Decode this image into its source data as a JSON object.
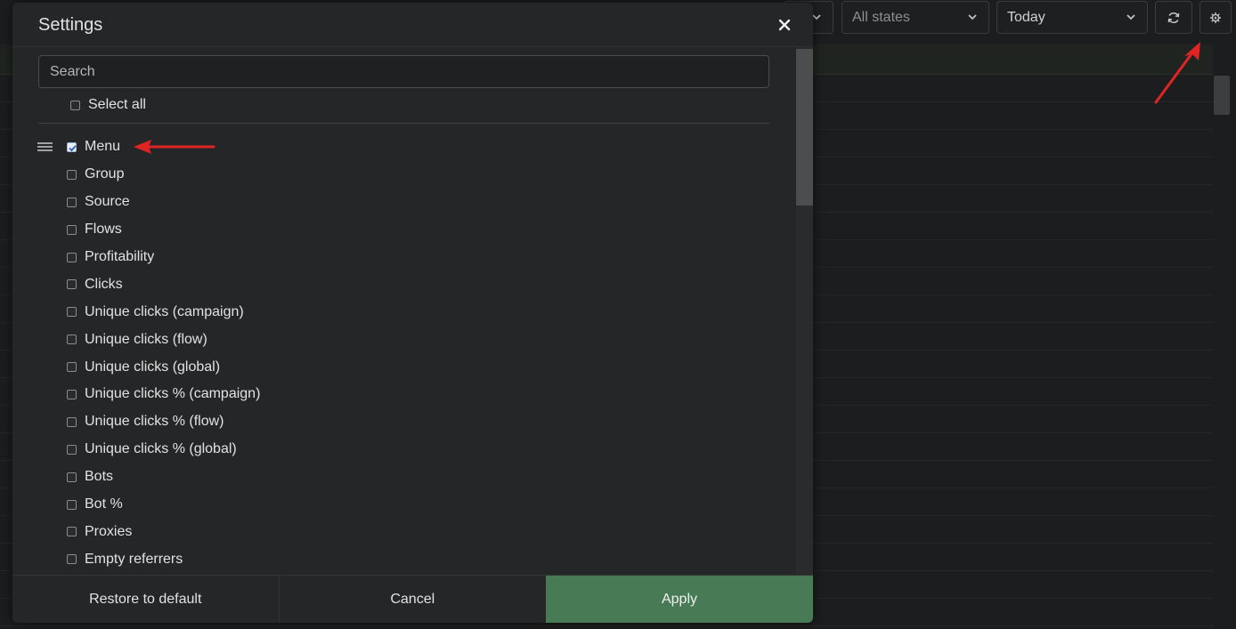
{
  "topbar": {
    "state_filter": "All states",
    "date_filter": "Today",
    "refresh_icon": "refresh-icon",
    "settings_icon": "gear-icon"
  },
  "modal": {
    "title": "Settings",
    "search_placeholder": "Search",
    "select_all_label": "Select all",
    "columns": [
      {
        "label": "Menu",
        "checked": true
      },
      {
        "label": "Group",
        "checked": false
      },
      {
        "label": "Source",
        "checked": false
      },
      {
        "label": "Flows",
        "checked": false
      },
      {
        "label": "Profitability",
        "checked": false
      },
      {
        "label": "Clicks",
        "checked": false
      },
      {
        "label": "Unique clicks (campaign)",
        "checked": false
      },
      {
        "label": "Unique clicks (flow)",
        "checked": false
      },
      {
        "label": "Unique clicks (global)",
        "checked": false
      },
      {
        "label": "Unique clicks % (campaign)",
        "checked": false
      },
      {
        "label": "Unique clicks % (flow)",
        "checked": false
      },
      {
        "label": "Unique clicks % (global)",
        "checked": false
      },
      {
        "label": "Bots",
        "checked": false
      },
      {
        "label": "Bot %",
        "checked": false
      },
      {
        "label": "Proxies",
        "checked": false
      },
      {
        "label": "Empty referrers",
        "checked": false
      }
    ],
    "footer": {
      "restore_label": "Restore to default",
      "cancel_label": "Cancel",
      "apply_label": "Apply"
    }
  },
  "colors": {
    "apply": "#477a55",
    "annotation_arrow": "#e02424",
    "background": "#1c1d1e",
    "modal": "#252627"
  }
}
